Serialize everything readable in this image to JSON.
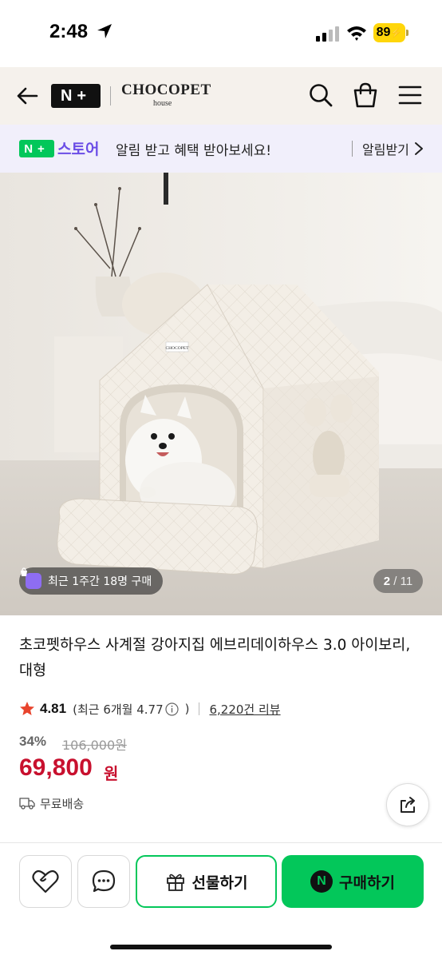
{
  "status_bar": {
    "time": "2:48",
    "battery": "89"
  },
  "header": {
    "nplus_logo": "N+",
    "brand_name": "CHOCOPET",
    "brand_sub": "house"
  },
  "notify_banner": {
    "badge": "N+",
    "store": "스토어",
    "text": "알림 받고 혜택 받아보세요!",
    "action": "알림받기"
  },
  "gallery": {
    "sales_text": "최근 1주간 18명 구매",
    "current_page": "2",
    "total_pages": "/ 11",
    "product_label": "CHOCOPET"
  },
  "product": {
    "title": "초코펫하우스 사계절 강아지집 에브리데이하우스 3.0 아이보리, 대형",
    "rating": "4.81",
    "recent_rating": "(최근 6개월 4.77",
    "recent_rating_close": ")",
    "review_count": "6,220건 리뷰",
    "discount_rate": "34%",
    "original_price": "106,000원",
    "price": "69,800",
    "price_unit": "원",
    "delivery": "무료배송"
  },
  "bottom_bar": {
    "gift_label": "선물하기",
    "buy_badge": "N",
    "buy_label": "구매하기"
  },
  "colors": {
    "naver_green": "#03c75a",
    "price_red": "#c8102e",
    "store_purple": "#6b4de6",
    "star": "#e8442d"
  }
}
